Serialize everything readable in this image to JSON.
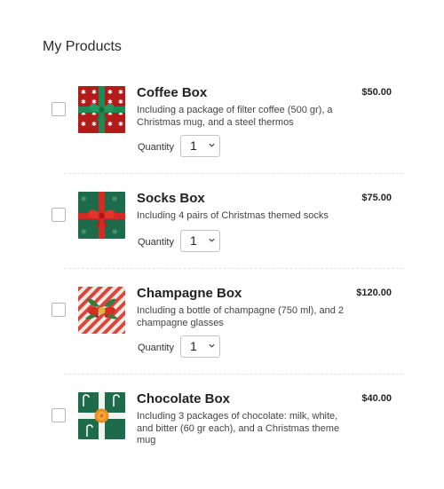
{
  "page": {
    "title": "My Products"
  },
  "products": [
    {
      "name": "Coffee Box",
      "description": "Including a package of filter coffee (500 gr), a Christmas mug, and a steel thermos",
      "price": "$50.00",
      "quantity_label": "Quantity",
      "quantity": "1",
      "image_icon": "gift-box-red-snowflake-icon"
    },
    {
      "name": "Socks Box",
      "description": "Including 4 pairs of Christmas themed socks",
      "price": "$75.00",
      "quantity_label": "Quantity",
      "quantity": "1",
      "image_icon": "gift-box-green-snowflake-icon"
    },
    {
      "name": "Champagne Box",
      "description": "Including a bottle of champagne (750 ml), and 2 champagne glasses",
      "price": "$120.00",
      "quantity_label": "Quantity",
      "quantity": "1",
      "image_icon": "gift-box-candy-stripe-icon"
    },
    {
      "name": "Chocolate Box",
      "description": "Including 3 packages of chocolate: milk, white, and bitter (60 gr each), and a Christmas theme mug",
      "price": "$40.00",
      "quantity_label": "Quantity",
      "quantity": "1",
      "image_icon": "gift-box-green-candycane-icon"
    }
  ],
  "colors": {
    "gift_red": "#b31b1b",
    "gift_green": "#1e6b4b",
    "ribbon_red": "#d32a23",
    "ribbon_green": "#1f8a55",
    "text": "#2b2b2b"
  }
}
